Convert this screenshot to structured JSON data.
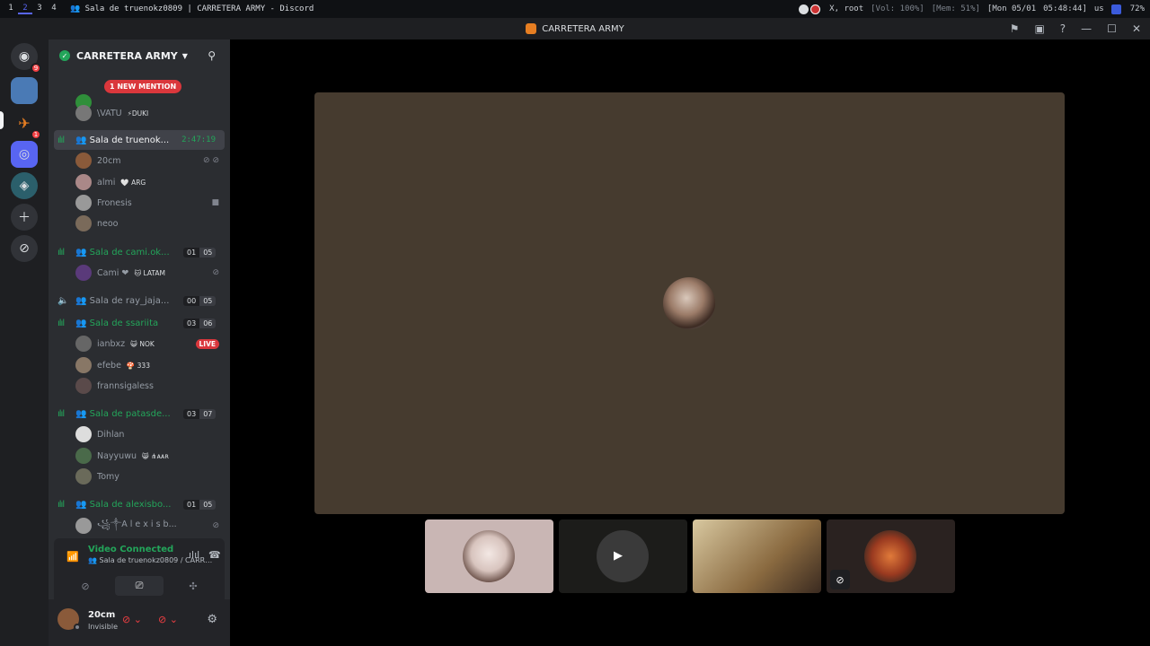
{
  "system_bar": {
    "workspaces": [
      "1",
      "2",
      "3",
      "4"
    ],
    "active_workspace": "2",
    "window_title": "👥 Sala de truenokz0809 | CARRETERA ARMY - Discord",
    "user": "root",
    "volume": "[Vol: 100%]",
    "memory": "[Mem: 51%]",
    "date": "[Mon 05/01",
    "time": "05:48:44]",
    "layout": "us",
    "battery": "72%"
  },
  "title_bar": {
    "title": "CARRETERA ARMY"
  },
  "guilds": {
    "home_badge": "9",
    "server2_badge": "1"
  },
  "server": {
    "name": "CARRETERA ARMY",
    "new_mention": "1 NEW MENTION"
  },
  "channels": {
    "top_members": [
      {
        "name": "\\VATU",
        "tag": "⚡DUKI"
      }
    ],
    "sala1": {
      "name": "👥 Sala de truenok...",
      "timer": "2:47:19"
    },
    "sala1_members": [
      {
        "name": "20cm"
      },
      {
        "name": "almi",
        "tag": "🤍 ARG"
      },
      {
        "name": "Fronesis"
      },
      {
        "name": "neoo"
      }
    ],
    "sala2": {
      "name": "👥 Sala de cami.ok...",
      "count_a": "01",
      "count_b": "05"
    },
    "sala2_members": [
      {
        "name": "Cami ❤",
        "tag": "🐱 LATAM"
      }
    ],
    "sala3": {
      "name": "👥 Sala de ray_jaja...",
      "count_a": "00",
      "count_b": "05"
    },
    "sala4": {
      "name": "👥 Sala de ssariita",
      "count_a": "03",
      "count_b": "06"
    },
    "sala4_members": [
      {
        "name": "ianbxz",
        "tag": "😺 NOK",
        "live": "LIVE"
      },
      {
        "name": "efebe",
        "tag": "🍄 333"
      },
      {
        "name": "frannsigaless"
      }
    ],
    "sala5": {
      "name": "👥 Sala de patasde...",
      "count_a": "03",
      "count_b": "07"
    },
    "sala5_members": [
      {
        "name": "Dihlan"
      },
      {
        "name": "Nayyuwu",
        "tag": "😸 ⋔ᴀᴀʀ"
      },
      {
        "name": "Tomy"
      }
    ],
    "sala6": {
      "name": "👥 Sala de alexisbo...",
      "count_a": "01",
      "count_b": "05"
    },
    "sala6_members": [
      {
        "name": "꧁༒A l e x i s b..."
      }
    ]
  },
  "voice_panel": {
    "status": "Video Connected",
    "channel": "👥 Sala de truenokz0809 / CARRE..."
  },
  "user_panel": {
    "name": "20cm",
    "status": "Invisible"
  },
  "colors": {
    "accent": "#5865f2",
    "connected": "#23a55a",
    "danger": "#f23f43",
    "focus_bg": "#463b2f"
  }
}
